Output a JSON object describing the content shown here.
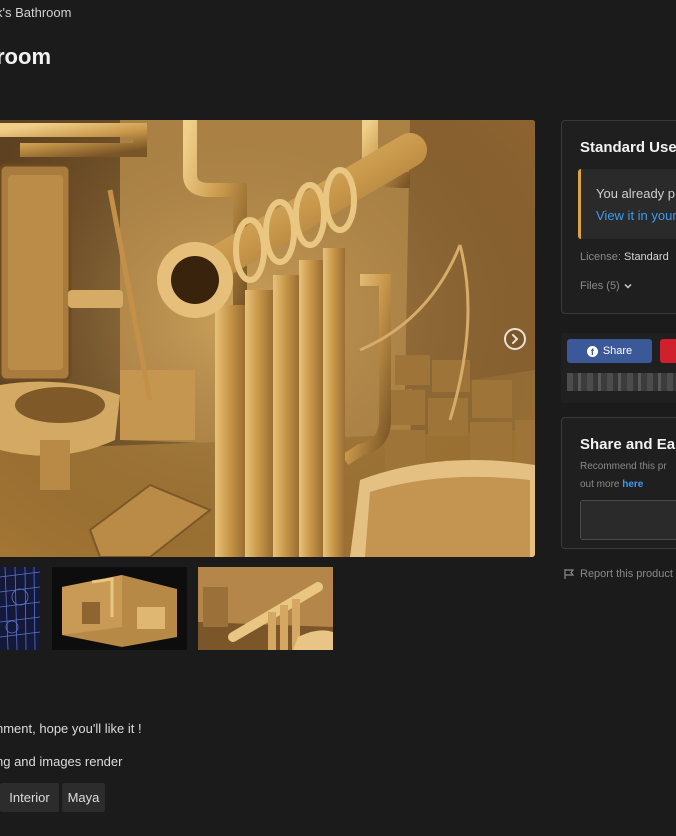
{
  "breadcrumb": {
    "current": "k's Bathroom"
  },
  "product": {
    "title": "room"
  },
  "license_card": {
    "heading": "Standard Use",
    "notice_line1": "You already p",
    "notice_line2": "View it in your",
    "license_label": "License:",
    "license_value": "Standard",
    "files_label": "Files (5)",
    "accent_color": "#d9a441"
  },
  "share": {
    "facebook_label": "Share",
    "facebook_color": "#3b5998",
    "pinterest_color": "#d0202b"
  },
  "earn_card": {
    "heading": "Share and Ear",
    "desc_line1": "Recommend this pr",
    "desc_line2": "out more",
    "desc_link": "here"
  },
  "report": {
    "label": "Report this product"
  },
  "description": {
    "line1": "nment, hope you'll like it !",
    "line2": "ng and images render"
  },
  "tags": [
    "Interior",
    "Maya"
  ],
  "icons": {
    "next": "chevron-right-icon",
    "files_toggle": "chevron-down-icon",
    "report": "flag-icon",
    "facebook": "facebook-icon"
  }
}
